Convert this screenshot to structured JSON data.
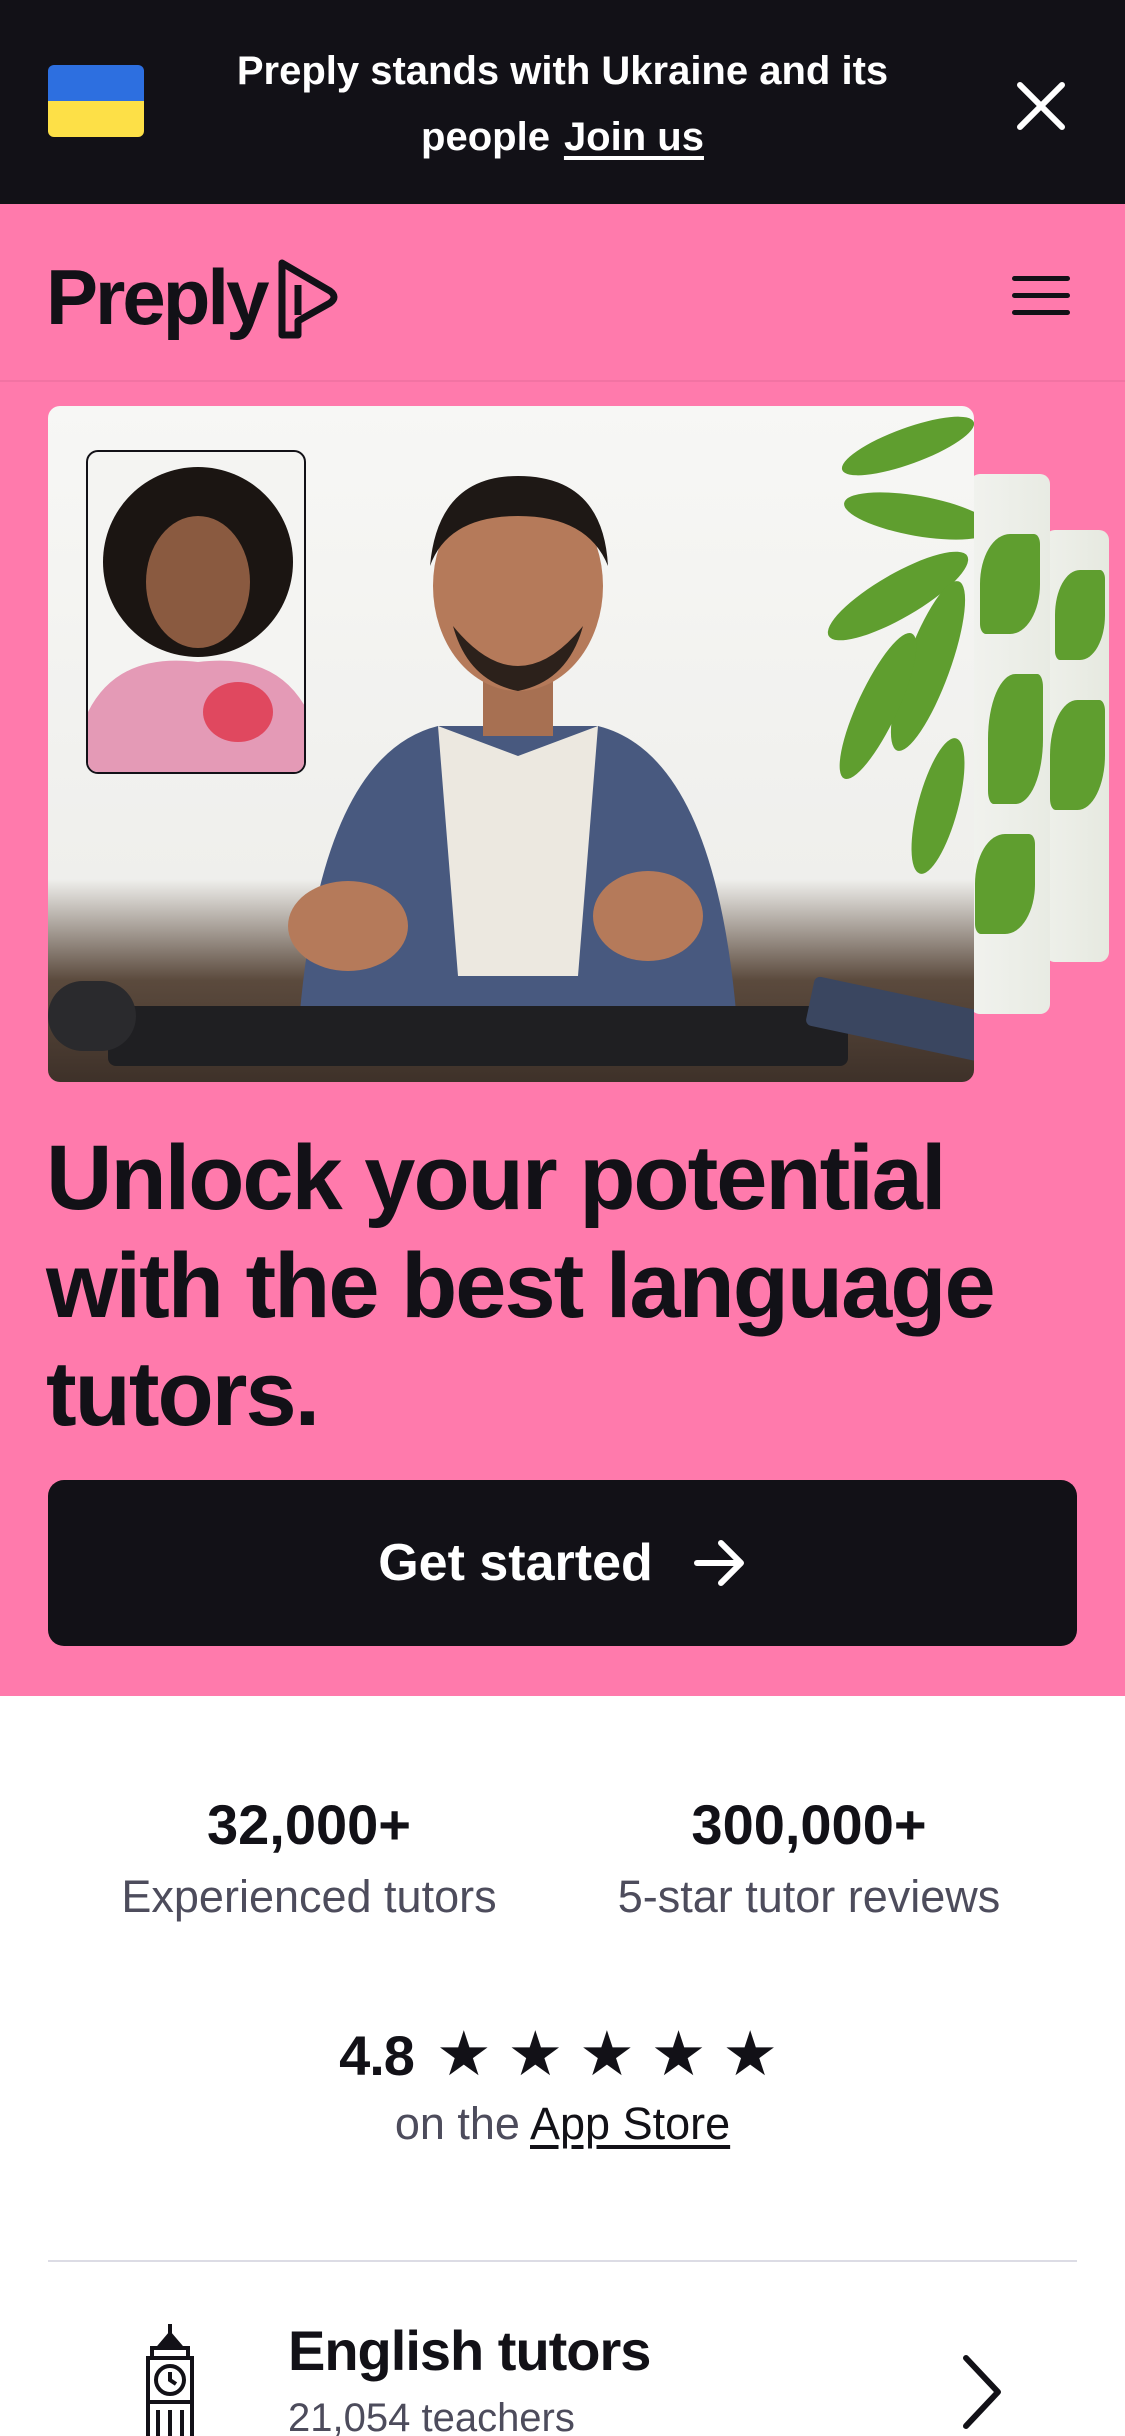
{
  "banner": {
    "line1": "Preply stands with Ukraine and its",
    "line2": "people",
    "link": "Join us",
    "close_icon": "close-icon",
    "flag_colors": [
      "#2d6fe0",
      "#fde047"
    ]
  },
  "header": {
    "logo_text": "Preply",
    "menu_icon": "hamburger-menu-icon"
  },
  "hero": {
    "background": "#ff7aac",
    "headline": "Unlock your potential with the best language tutors.",
    "cta_label": "Get started",
    "cta_icon": "arrow-right-icon"
  },
  "stats": [
    {
      "value": "32,000+",
      "label": "Experienced tutors"
    },
    {
      "value": "300,000+",
      "label": "5-star tutor reviews"
    }
  ],
  "rating": {
    "value": "4.8",
    "stars": 5,
    "prefix": "on the",
    "link": "App Store"
  },
  "categories": [
    {
      "title": "English tutors",
      "count": "21,054 teachers",
      "icon": "big-ben-icon"
    }
  ]
}
